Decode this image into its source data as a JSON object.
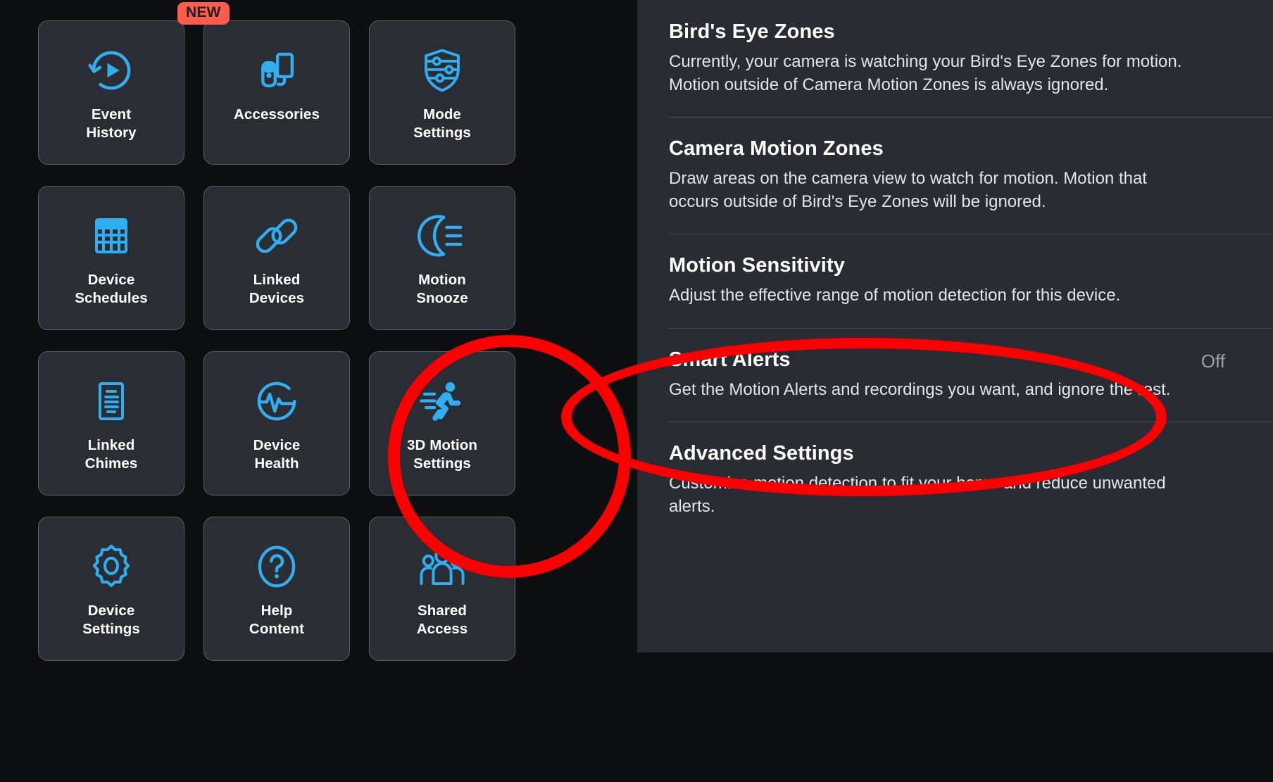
{
  "colors": {
    "page_background": "#0d0e10",
    "tile_background": "#2a2e34",
    "tile_border": "#5a5f66",
    "icon_accent": "#31aef0",
    "panel_background": "#292d33",
    "divider": "#4a4f56",
    "badge_background": "#ff5c4d",
    "annotation_red": "#fa0000",
    "value_text": "#9aa0a6"
  },
  "tile_grid": {
    "tiles": [
      {
        "id": "event-history",
        "icon": "history-replay-icon",
        "label": "Event\nHistory",
        "badge": null
      },
      {
        "id": "accessories",
        "icon": "accessories-icon",
        "label": "Accessories",
        "badge": "NEW"
      },
      {
        "id": "mode-settings",
        "icon": "shield-sliders-icon",
        "label": "Mode\nSettings",
        "badge": null
      },
      {
        "id": "device-schedules",
        "icon": "calendar-icon",
        "label": "Device\nSchedules",
        "badge": null
      },
      {
        "id": "linked-devices",
        "icon": "chain-link-icon",
        "label": "Linked\nDevices",
        "badge": null
      },
      {
        "id": "motion-snooze",
        "icon": "moon-snooze-icon",
        "label": "Motion\nSnooze",
        "badge": null
      },
      {
        "id": "linked-chimes",
        "icon": "document-lines-icon",
        "label": "Linked\nChimes",
        "badge": null
      },
      {
        "id": "device-health",
        "icon": "heartbeat-circle-icon",
        "label": "Device\nHealth",
        "badge": null
      },
      {
        "id": "3d-motion-settings",
        "icon": "running-person-icon",
        "label": "3D Motion\nSettings",
        "badge": null
      },
      {
        "id": "device-settings",
        "icon": "gear-icon",
        "label": "Device\nSettings",
        "badge": null
      },
      {
        "id": "help-content",
        "icon": "question-mark-icon",
        "label": "Help\nContent",
        "badge": null
      },
      {
        "id": "shared-access",
        "icon": "people-group-icon",
        "label": "Shared\nAccess",
        "badge": null
      }
    ]
  },
  "settings_panel": {
    "rows": [
      {
        "id": "birds-eye-zones",
        "title": "Bird's Eye Zones",
        "description": "Currently, your camera is watching your Bird's Eye Zones for motion. Motion outside of Camera Motion Zones is always ignored.",
        "value": null
      },
      {
        "id": "camera-motion-zones",
        "title": "Camera Motion Zones",
        "description": "Draw areas on the camera view to watch for motion. Motion that occurs outside of Bird's Eye Zones will be ignored.",
        "value": null
      },
      {
        "id": "motion-sensitivity",
        "title": "Motion Sensitivity",
        "description": "Adjust the effective range of motion detection for this device.",
        "value": null
      },
      {
        "id": "smart-alerts",
        "title": "Smart Alerts",
        "description": "Get the Motion Alerts and recordings you want, and ignore the rest.",
        "value": "Off"
      },
      {
        "id": "advanced-settings",
        "title": "Advanced Settings",
        "description": "Customize motion detection to fit your home and reduce unwanted alerts.",
        "value": null
      }
    ]
  },
  "annotations": [
    {
      "id": "circle-3d-motion-settings",
      "shape": "circle",
      "target": "3D Motion Settings tile"
    },
    {
      "id": "ellipse-smart-alerts",
      "shape": "ellipse",
      "target": "Smart Alerts row"
    }
  ]
}
